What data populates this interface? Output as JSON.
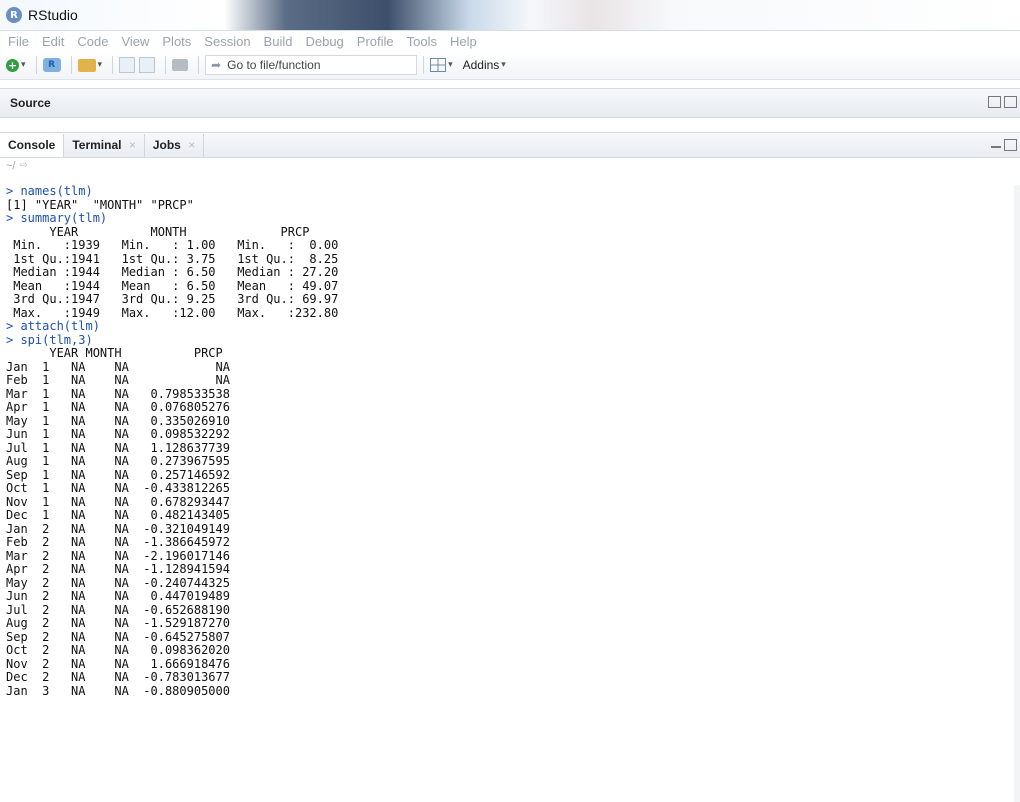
{
  "window": {
    "app_icon": "R",
    "title": "RStudio"
  },
  "menu": [
    "File",
    "Edit",
    "Code",
    "View",
    "Plots",
    "Session",
    "Build",
    "Debug",
    "Profile",
    "Tools",
    "Help"
  ],
  "toolbar": {
    "goto_placeholder": "Go to file/function",
    "addins_label": "Addins"
  },
  "source_pane": {
    "title": "Source"
  },
  "console_pane": {
    "tabs": [
      {
        "label": "Console",
        "closable": false
      },
      {
        "label": "Terminal",
        "closable": true
      },
      {
        "label": "Jobs",
        "closable": true
      }
    ],
    "path": "~/"
  },
  "console": {
    "lines": [
      {
        "type": "input",
        "text": "> names(tlm)"
      },
      {
        "type": "output",
        "text": "[1] \"YEAR\"  \"MONTH\" \"PRCP\""
      },
      {
        "type": "input",
        "text": "> summary(tlm)"
      },
      {
        "type": "output",
        "text": "      YEAR          MONTH             PRCP       "
      },
      {
        "type": "output",
        "text": " Min.   :1939   Min.   : 1.00   Min.   :  0.00  "
      },
      {
        "type": "output",
        "text": " 1st Qu.:1941   1st Qu.: 3.75   1st Qu.:  8.25  "
      },
      {
        "type": "output",
        "text": " Median :1944   Median : 6.50   Median : 27.20  "
      },
      {
        "type": "output",
        "text": " Mean   :1944   Mean   : 6.50   Mean   : 49.07  "
      },
      {
        "type": "output",
        "text": " 3rd Qu.:1947   3rd Qu.: 9.25   3rd Qu.: 69.97  "
      },
      {
        "type": "output",
        "text": " Max.   :1949   Max.   :12.00   Max.   :232.80  "
      },
      {
        "type": "input",
        "text": "> attach(tlm)"
      },
      {
        "type": "input",
        "text": "> spi(tlm,3)"
      },
      {
        "type": "output",
        "text": "      YEAR MONTH          PRCP"
      },
      {
        "type": "output",
        "text": "Jan  1   NA    NA            NA"
      },
      {
        "type": "output",
        "text": "Feb  1   NA    NA            NA"
      },
      {
        "type": "output",
        "text": "Mar  1   NA    NA   0.798533538"
      },
      {
        "type": "output",
        "text": "Apr  1   NA    NA   0.076805276"
      },
      {
        "type": "output",
        "text": "May  1   NA    NA   0.335026910"
      },
      {
        "type": "output",
        "text": "Jun  1   NA    NA   0.098532292"
      },
      {
        "type": "output",
        "text": "Jul  1   NA    NA   1.128637739"
      },
      {
        "type": "output",
        "text": "Aug  1   NA    NA   0.273967595"
      },
      {
        "type": "output",
        "text": "Sep  1   NA    NA   0.257146592"
      },
      {
        "type": "output",
        "text": "Oct  1   NA    NA  -0.433812265"
      },
      {
        "type": "output",
        "text": "Nov  1   NA    NA   0.678293447"
      },
      {
        "type": "output",
        "text": "Dec  1   NA    NA   0.482143405"
      },
      {
        "type": "output",
        "text": "Jan  2   NA    NA  -0.321049149"
      },
      {
        "type": "output",
        "text": "Feb  2   NA    NA  -1.386645972"
      },
      {
        "type": "output",
        "text": "Mar  2   NA    NA  -2.196017146"
      },
      {
        "type": "output",
        "text": "Apr  2   NA    NA  -1.128941594"
      },
      {
        "type": "output",
        "text": "May  2   NA    NA  -0.240744325"
      },
      {
        "type": "output",
        "text": "Jun  2   NA    NA   0.447019489"
      },
      {
        "type": "output",
        "text": "Jul  2   NA    NA  -0.652688190"
      },
      {
        "type": "output",
        "text": "Aug  2   NA    NA  -1.529187270"
      },
      {
        "type": "output",
        "text": "Sep  2   NA    NA  -0.645275807"
      },
      {
        "type": "output",
        "text": "Oct  2   NA    NA   0.098362020"
      },
      {
        "type": "output",
        "text": "Nov  2   NA    NA   1.666918476"
      },
      {
        "type": "output",
        "text": "Dec  2   NA    NA  -0.783013677"
      },
      {
        "type": "output",
        "text": "Jan  3   NA    NA  -0.880905000"
      }
    ]
  },
  "colors": {
    "input_text": "#1d50b0",
    "output_text": "#111111"
  },
  "icons": {
    "new_file": "plus-circle-icon",
    "project": "project-icon",
    "open": "folder-open-icon",
    "save": "save-icon",
    "save_all": "save-all-icon",
    "print": "print-icon",
    "goto": "arrow-right-icon",
    "layout": "grid-icon"
  }
}
